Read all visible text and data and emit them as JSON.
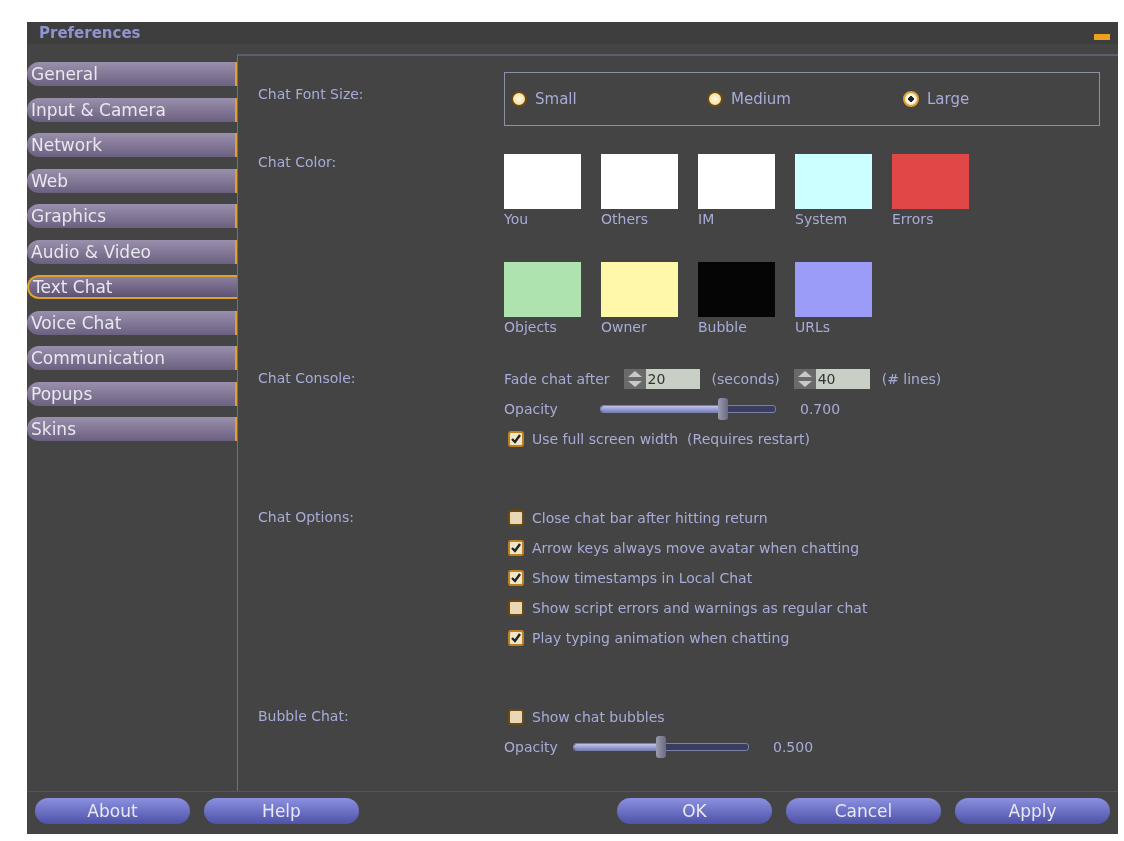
{
  "window": {
    "title": "Preferences"
  },
  "tabs": [
    {
      "label": "General",
      "selected": false
    },
    {
      "label": "Input & Camera",
      "selected": false
    },
    {
      "label": "Network",
      "selected": false
    },
    {
      "label": "Web",
      "selected": false
    },
    {
      "label": "Graphics",
      "selected": false
    },
    {
      "label": "Audio & Video",
      "selected": false
    },
    {
      "label": "Text Chat",
      "selected": true
    },
    {
      "label": "Voice Chat",
      "selected": false
    },
    {
      "label": "Communication",
      "selected": false
    },
    {
      "label": "Popups",
      "selected": false
    },
    {
      "label": "Skins",
      "selected": false
    }
  ],
  "font_size": {
    "label": "Chat Font Size:",
    "options": [
      {
        "label": "Small",
        "selected": false
      },
      {
        "label": "Medium",
        "selected": false
      },
      {
        "label": "Large",
        "selected": true
      }
    ]
  },
  "chat_color": {
    "label": "Chat Color:",
    "swatches": [
      {
        "label": "You",
        "color": "#ffffff"
      },
      {
        "label": "Others",
        "color": "#ffffff"
      },
      {
        "label": "IM",
        "color": "#ffffff"
      },
      {
        "label": "System",
        "color": "#ccffff"
      },
      {
        "label": "Errors",
        "color": "#e04848"
      },
      {
        "label": "Objects",
        "color": "#aee3b0"
      },
      {
        "label": "Owner",
        "color": "#fff8a8"
      },
      {
        "label": "Bubble",
        "color": "#050505"
      },
      {
        "label": "URLs",
        "color": "#9b9cf8"
      }
    ]
  },
  "chat_console": {
    "label": "Chat Console:",
    "fade_prefix": "Fade chat after",
    "seconds": "20",
    "seconds_unit": "(seconds)",
    "lines": "40",
    "lines_unit": "(# lines)",
    "opacity": {
      "label": "Opacity",
      "level": 0.7,
      "reading": "0.700"
    },
    "full_width": {
      "label": "Use full screen width  (Requires restart)",
      "checked": true
    }
  },
  "chat_options": {
    "label": "Chat Options:",
    "items": [
      {
        "label": "Close chat bar after hitting return",
        "checked": false
      },
      {
        "label": "Arrow keys always move avatar when chatting",
        "checked": true
      },
      {
        "label": "Show timestamps in Local Chat",
        "checked": true
      },
      {
        "label": "Show script errors and warnings as regular chat",
        "checked": false
      },
      {
        "label": "Play typing animation when chatting",
        "checked": true
      }
    ]
  },
  "bubble_chat": {
    "label": "Bubble Chat:",
    "show_bubbles": {
      "label": "Show chat bubbles",
      "checked": false
    },
    "opacity": {
      "label": "Opacity",
      "level": 0.5,
      "reading": "0.500"
    }
  },
  "buttons": [
    {
      "label": "About"
    },
    {
      "label": "Help"
    },
    {
      "label": "OK"
    },
    {
      "label": "Cancel"
    },
    {
      "label": "Apply"
    }
  ]
}
